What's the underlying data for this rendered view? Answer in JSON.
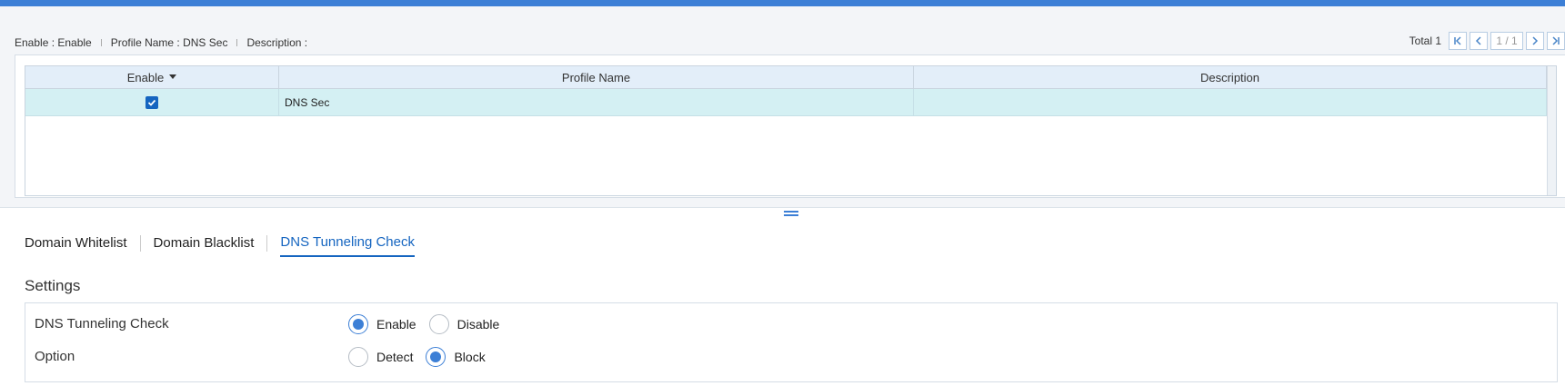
{
  "filter_bar": {
    "enable_text": "Enable : Enable",
    "profile_text": "Profile Name : DNS Sec",
    "description_text": "Description :"
  },
  "pager": {
    "total": "Total 1",
    "pages": "1 / 1",
    "first_icon": "first-page-icon",
    "prev_icon": "prev-page-icon",
    "next_icon": "next-page-icon",
    "last_icon": "last-page-icon"
  },
  "grid": {
    "columns": [
      "Enable",
      "Profile Name",
      "Description"
    ],
    "sort_icon": "sort-desc-icon",
    "rows": [
      {
        "enabled": true,
        "profile_name": "DNS Sec",
        "description": ""
      }
    ]
  },
  "tabs": [
    {
      "label": "Domain Whitelist",
      "active": false
    },
    {
      "label": "Domain Blacklist",
      "active": false
    },
    {
      "label": "DNS Tunneling Check",
      "active": true
    }
  ],
  "settings": {
    "title": "Settings",
    "rows": [
      {
        "label": "DNS Tunneling Check",
        "options": [
          "Enable",
          "Disable"
        ],
        "selected": "Enable"
      },
      {
        "label": "Option",
        "options": [
          "Detect",
          "Block"
        ],
        "selected": "Block"
      }
    ]
  },
  "colors": {
    "accent": "#1565c0",
    "topbar": "#3c7fd6",
    "selected_row": "#d4f0f3",
    "header_bg": "#e3eef9"
  }
}
